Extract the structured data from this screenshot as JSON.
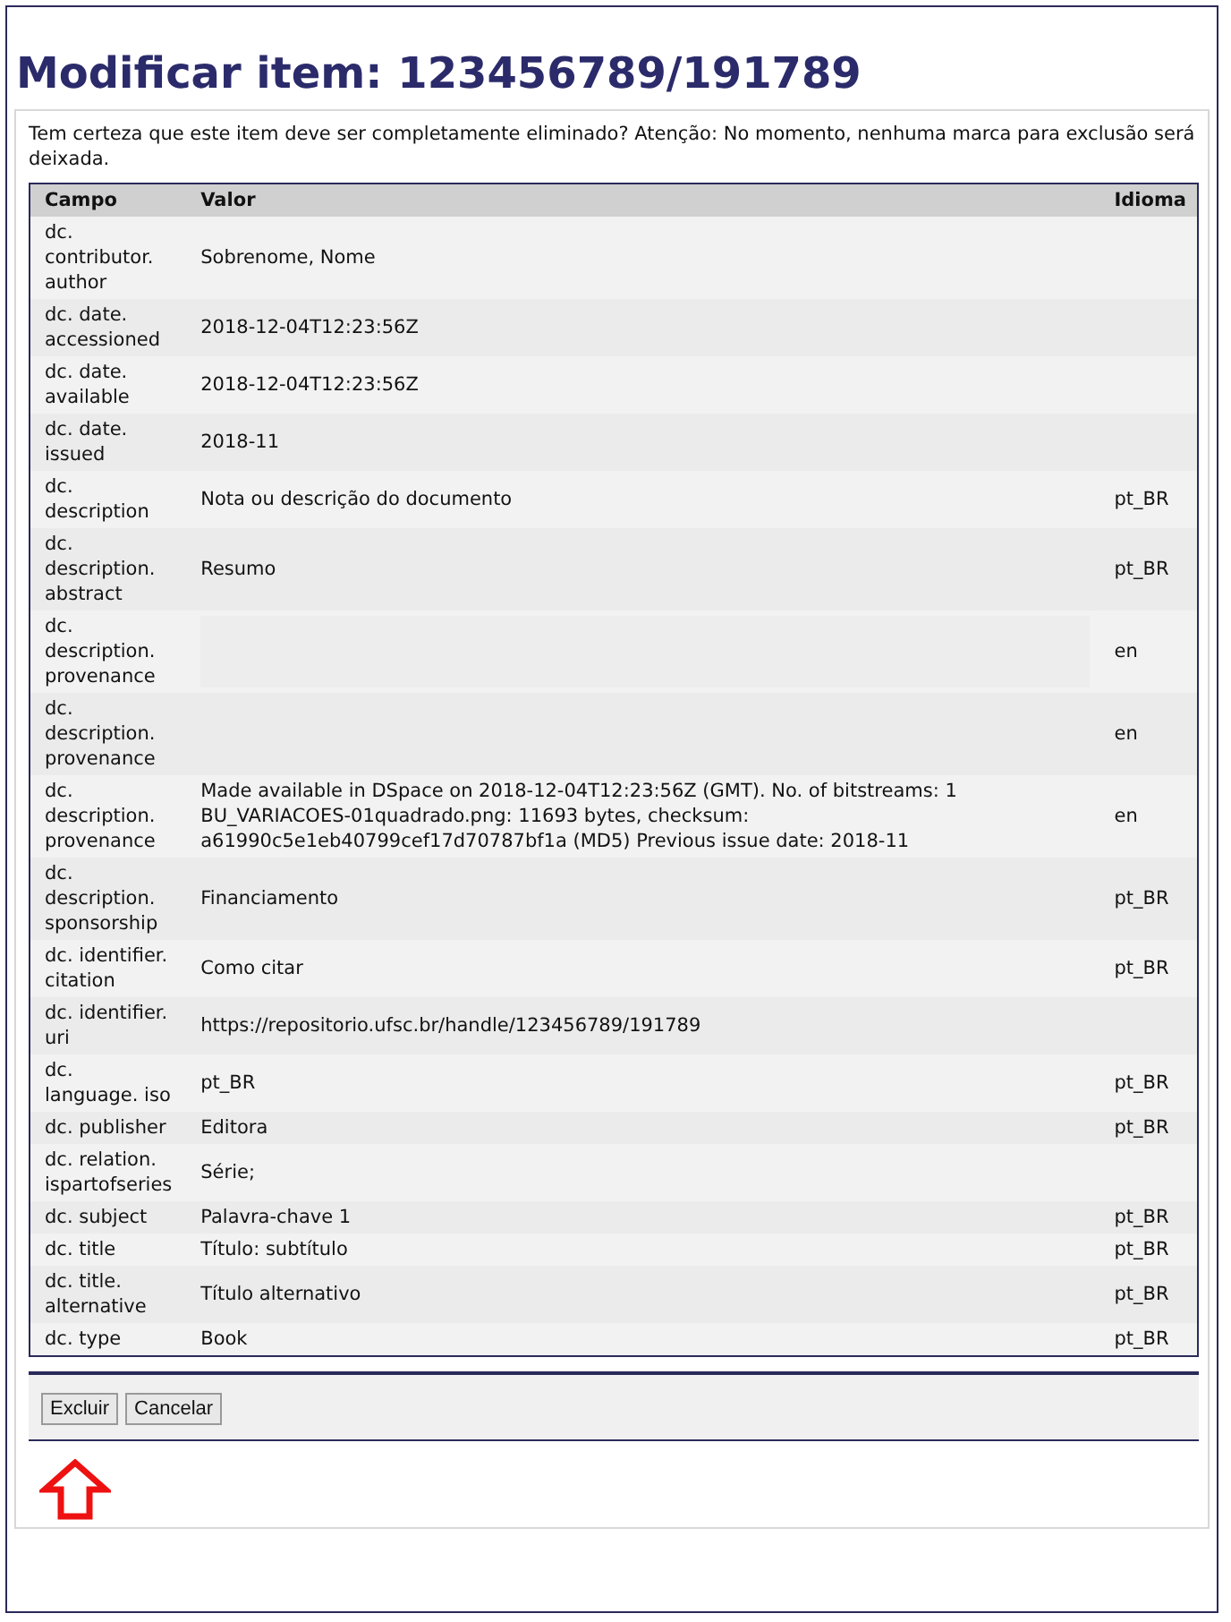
{
  "title": "Modificar item: 123456789/191789",
  "warning": "Tem certeza que este item deve ser completamente eliminado? Atenção: No momento, nenhuma marca para exclusão será deixada.",
  "table": {
    "columns": [
      "Campo",
      "Valor",
      "Idioma"
    ],
    "rows": [
      {
        "field": "dc. contributor. author",
        "value": "Sobrenome, Nome"
      },
      {
        "field": "dc. date. accessioned",
        "value": "2018-12-04T12:23:56Z"
      },
      {
        "field": "dc. date. available",
        "value": "2018-12-04T12:23:56Z"
      },
      {
        "field": "dc. date. issued",
        "value": "2018-11"
      },
      {
        "field": "dc. description",
        "value": "Nota ou descrição do documento",
        "language": "pt_BR"
      },
      {
        "field": "dc. description. abstract",
        "value": "Resumo",
        "language": "pt_BR"
      },
      {
        "field": "dc. description. provenance",
        "language": "en",
        "redacted": true
      },
      {
        "field": "dc. description. provenance",
        "language": "en"
      },
      {
        "field": "dc. description. provenance",
        "value": "Made available in DSpace on 2018-12-04T12:23:56Z (GMT). No. of bitstreams: 1 BU_VARIACOES-01quadrado.png: 11693 bytes, checksum: a61990c5e1eb40799cef17d70787bf1a (MD5) Previous issue date: 2018-11",
        "language": "en"
      },
      {
        "field": "dc. description. sponsorship",
        "value": "Financiamento",
        "language": "pt_BR"
      },
      {
        "field": "dc. identifier. citation",
        "value": "Como citar",
        "language": "pt_BR"
      },
      {
        "field": "dc. identifier. uri",
        "value": "https://repositorio.ufsc.br/handle/123456789/191789"
      },
      {
        "field": "dc. language. iso",
        "value": "pt_BR",
        "language": "pt_BR"
      },
      {
        "field": "dc. publisher",
        "value": "Editora",
        "language": "pt_BR"
      },
      {
        "field": "dc. relation. ispartofseries",
        "value": "Série;"
      },
      {
        "field": "dc. subject",
        "value": "Palavra-chave 1",
        "language": "pt_BR"
      },
      {
        "field": "dc. title",
        "value": "Título: subtítulo",
        "language": "pt_BR"
      },
      {
        "field": "dc. title. alternative",
        "value": "Título alternativo",
        "language": "pt_BR"
      },
      {
        "field": "dc. type",
        "value": "Book",
        "language": "pt_BR"
      }
    ]
  },
  "buttons": [
    "Excluir",
    "Cancelar"
  ]
}
